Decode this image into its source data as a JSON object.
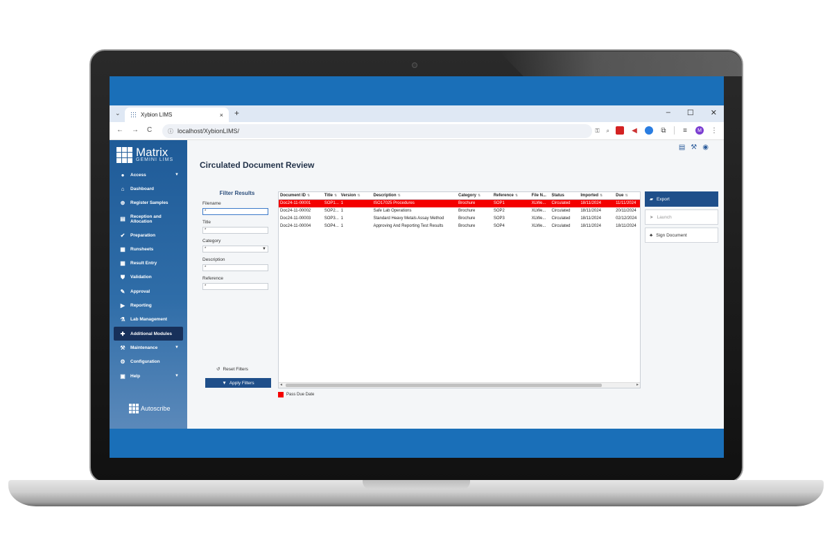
{
  "browser": {
    "tab_title": "Xybion LIMS",
    "tab_close": "×",
    "new_tab": "+",
    "tab_dropdown": "⌄",
    "url": "localhost/XybionLIMS/",
    "window_controls": [
      "–",
      "☐",
      "✕"
    ]
  },
  "brand": {
    "name": "Matrix",
    "subtitle": "GEMINI LIMS",
    "footer": "Autoscribe"
  },
  "sidebar": {
    "items": [
      {
        "label": "Access",
        "icon": "person-icon",
        "caret": true
      },
      {
        "label": "Dashboard",
        "icon": "home-icon"
      },
      {
        "label": "Register Samples",
        "icon": "plus-icon"
      },
      {
        "label": "Reception and Allocation",
        "icon": "document-icon"
      },
      {
        "label": "Preparation",
        "icon": "flask-icon"
      },
      {
        "label": "Runsheets",
        "icon": "grid-icon"
      },
      {
        "label": "Result Entry",
        "icon": "table-icon"
      },
      {
        "label": "Validation",
        "icon": "shield-icon"
      },
      {
        "label": "Approval",
        "icon": "stamp-icon"
      },
      {
        "label": "Reporting",
        "icon": "report-icon"
      },
      {
        "label": "Lab Management",
        "icon": "beaker-icon"
      },
      {
        "label": "Additional Modules",
        "icon": "puzzle-icon",
        "active": true
      },
      {
        "label": "Maintenance",
        "icon": "wrench-icon",
        "caret": true
      },
      {
        "label": "Configuration",
        "icon": "gear-icon"
      },
      {
        "label": "Help",
        "icon": "help-icon",
        "caret": true
      }
    ]
  },
  "page": {
    "title": "Circulated Document Review"
  },
  "filter": {
    "heading": "Filter Results",
    "fields": [
      {
        "label": "Filename",
        "value": "*",
        "type": "text"
      },
      {
        "label": "Title",
        "value": "*",
        "type": "text"
      },
      {
        "label": "Category",
        "value": "*",
        "type": "select"
      },
      {
        "label": "Description",
        "value": "*",
        "type": "text"
      },
      {
        "label": "Reference",
        "value": "*",
        "type": "text"
      }
    ],
    "reset_label": "Reset Filters",
    "apply_label": "Apply Filters"
  },
  "grid": {
    "columns": [
      "Document ID",
      "Title",
      "Version",
      "Description",
      "Category",
      "Reference",
      "File N...",
      "Status",
      "Imported",
      "Due"
    ],
    "rows": [
      {
        "overdue": true,
        "cells": [
          "Doc24-11-00001",
          "SOP1...",
          "1",
          "ISO17025 Procedures",
          "Brochure",
          "SOP1",
          "XLWe...",
          "Circulated",
          "18/11/2024",
          "11/11/2024"
        ]
      },
      {
        "overdue": false,
        "cells": [
          "Doc24-11-00002",
          "SOP2...",
          "1",
          "Safe Lab Operations",
          "Brochure",
          "SOP2",
          "XLWe...",
          "Circulated",
          "18/11/2024",
          "20/11/2024"
        ]
      },
      {
        "overdue": false,
        "cells": [
          "Doc24-11-00003",
          "SOP3...",
          "1",
          "Standard Heavy Metals Assay Method",
          "Brochure",
          "SOP3",
          "XLWe...",
          "Circulated",
          "18/11/2024",
          "02/12/2024"
        ]
      },
      {
        "overdue": false,
        "cells": [
          "Doc24-11-00004",
          "SOP4...",
          "1",
          "Approving And Reporting Test Results",
          "Brochure",
          "SOP4",
          "XLWe...",
          "Circulated",
          "18/11/2024",
          "18/11/2024"
        ]
      }
    ]
  },
  "legend": {
    "label": "Pass Due Date",
    "color": "#f40000"
  },
  "actions": {
    "export": "Export",
    "launch": "Launch",
    "sign": "Sign Document"
  },
  "colors": {
    "accent": "#1f4f8a",
    "overdue": "#f40000",
    "frame_blue": "#1a6fb8"
  }
}
